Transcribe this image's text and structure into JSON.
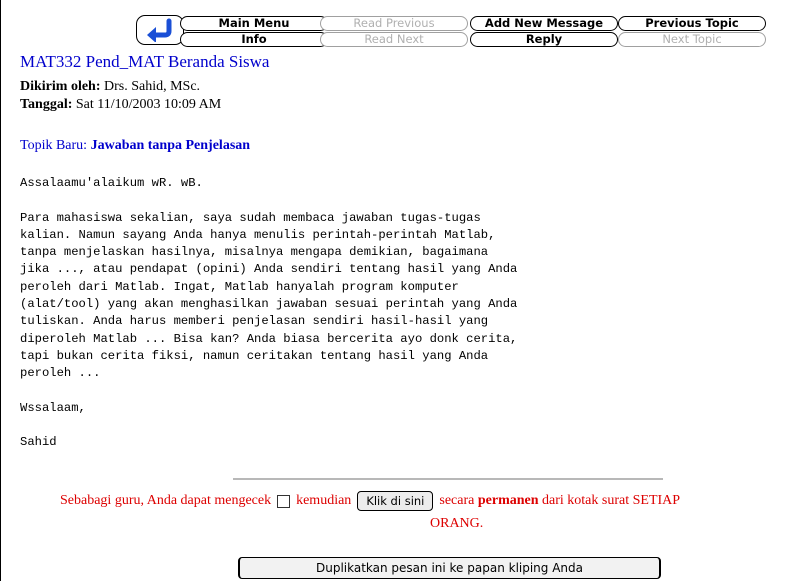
{
  "nav": {
    "back_icon": "back-arrow-icon",
    "main_menu": "Main Menu",
    "info": "Info",
    "read_previous": "Read Previous",
    "read_next": "Read Next",
    "add_new_message": "Add New Message",
    "reply": "Reply",
    "previous_topic": "Previous Topic",
    "next_topic": "Next Topic",
    "accent_color": "#1a4fd6"
  },
  "message": {
    "title": "MAT332 Pend_MAT Beranda Siswa",
    "sender_label": "Dikirim oleh:",
    "sender": "Drs. Sahid, MSc.",
    "date_label": "Tanggal:",
    "date": "Sat 11/10/2003 10:09 AM",
    "topic_label": "Topik Baru:",
    "topic": "Jawaban tanpa Penjelasan",
    "body": "Assalaamu'alaikum wR. wB.\n\nPara mahasiswa sekalian, saya sudah membaca jawaban tugas-tugas\nkalian. Namun sayang Anda hanya menulis perintah-perintah Matlab,\ntanpa menjelaskan hasilnya, misalnya mengapa demikian, bagaimana\njika ..., atau pendapat (opini) Anda sendiri tentang hasil yang Anda\nperoleh dari Matlab. Ingat, Matlab hanyalah program komputer\n(alat/tool) yang akan menghasilkan jawaban sesuai perintah yang Anda\ntuliskan. Anda harus memberi penjelasan sendiri hasil-hasil yang\ndiperoleh Matlab ... Bisa kan? Anda biasa bercerita ayo donk cerita,\ntapi bukan cerita fiksi, namun ceritakan tentang hasil yang Anda\nperoleh ...\n\nWssalaam,\n\nSahid"
  },
  "teacher_notice": {
    "text_before": "Sebabagi guru, Anda dapat mengecek",
    "text_middle": "kemudian",
    "button_label": "Klik di sini",
    "text_after": "secara",
    "text_bold": "permanen",
    "text_end": "dari kotak surat SETIAP",
    "text_line2": "ORANG.",
    "color": "#dd0000"
  },
  "duplicate_button": {
    "label": "Duplikatkan pesan ini ke papan kliping Anda"
  }
}
